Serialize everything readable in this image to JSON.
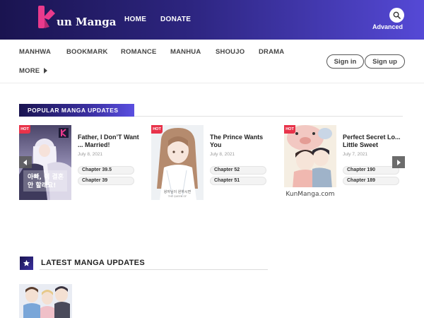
{
  "header": {
    "logo_text": "un Manga",
    "nav": [
      {
        "label": "HOME"
      },
      {
        "label": "DONATE"
      }
    ],
    "advanced_label": "Advanced",
    "search_icon": "search-icon",
    "colors": {
      "gradient_start": "#1a1450",
      "gradient_end": "#5549d6",
      "logo_accent": "#e93a8c"
    }
  },
  "categories": [
    "MANHWA",
    "BOOKMARK",
    "ROMANCE",
    "MANHUA",
    "SHOUJO",
    "DRAMA"
  ],
  "more_label": "MORE",
  "auth": {
    "sign_in": "Sign in",
    "sign_up": "Sign up"
  },
  "popular": {
    "title": "POPULAR MANGA UPDATES",
    "items": [
      {
        "badge": "HOT",
        "title": "Father, I Don’T Want ... Married!",
        "date": "July 8, 2021",
        "chapters": [
          "Chapter 39.5",
          "Chapter 39"
        ]
      },
      {
        "badge": "HOT",
        "title": "The Prince Wants You",
        "date": "July 8, 2021",
        "chapters": [
          "Chapter 52",
          "Chapter 51"
        ]
      },
      {
        "badge": "HOT",
        "title": "Perfect Secret Lo... Little Sweet",
        "date": "July 7, 2021",
        "chapters": [
          "Chapter 190",
          "Chapter 189"
        ],
        "cover_watermark": "KunManga.com"
      }
    ]
  },
  "latest": {
    "title": "LATEST MANGA UPDATES",
    "icon": "star-icon"
  }
}
